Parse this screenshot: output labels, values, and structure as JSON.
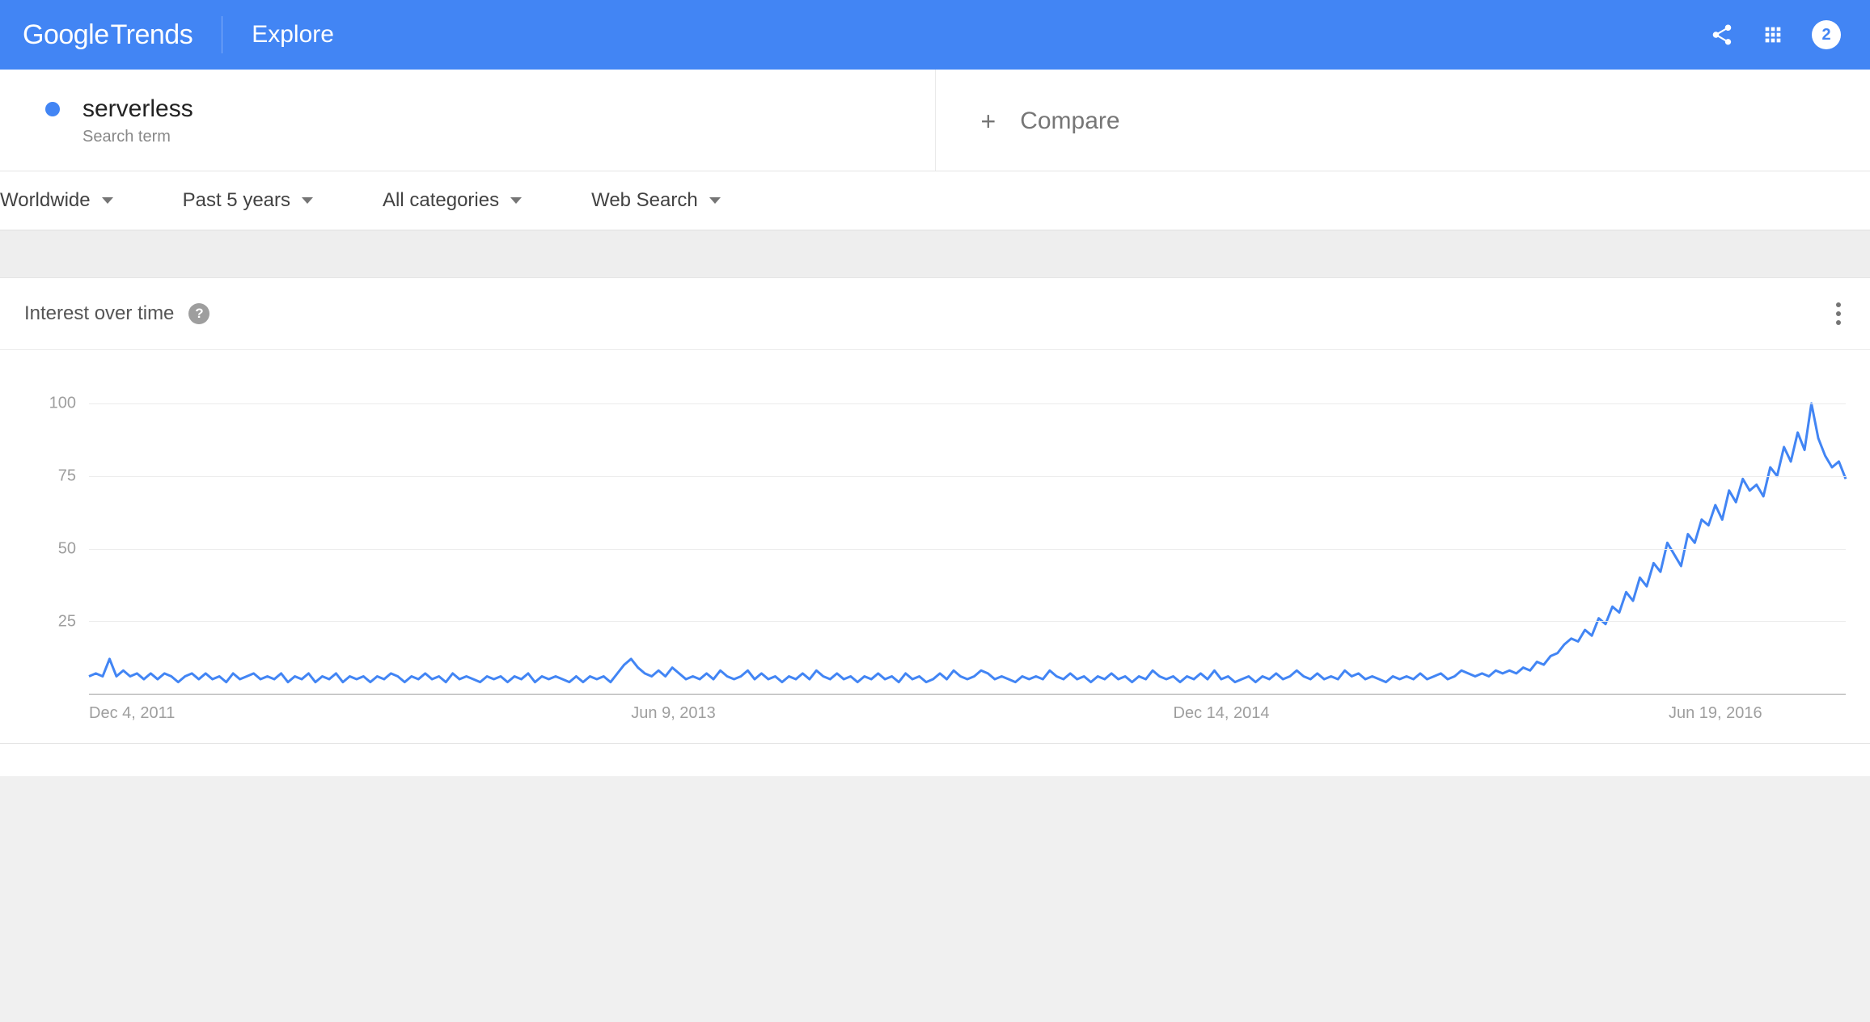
{
  "header": {
    "logo_google": "Google",
    "logo_trends": "Trends",
    "title": "Explore",
    "badge_count": "2"
  },
  "terms": {
    "primary": {
      "name": "serverless",
      "subtitle": "Search term",
      "color": "#4285F4"
    },
    "compare_label": "Compare"
  },
  "filters": {
    "region": "Worldwide",
    "timeframe": "Past 5 years",
    "category": "All categories",
    "search_type": "Web Search"
  },
  "card": {
    "title": "Interest over time"
  },
  "chart_data": {
    "type": "line",
    "title": "Interest over time",
    "xlabel": "",
    "ylabel": "",
    "ylim": [
      0,
      100
    ],
    "y_ticks": [
      25,
      50,
      75,
      100
    ],
    "x_tick_labels": [
      "Dec 4, 2011",
      "Jun 9, 2013",
      "Dec 14, 2014",
      "Jun 19, 2016"
    ],
    "x_tick_positions": [
      0,
      79,
      158,
      237
    ],
    "series": [
      {
        "name": "serverless",
        "color": "#4285F4",
        "values": [
          6,
          7,
          6,
          12,
          6,
          8,
          6,
          7,
          5,
          7,
          5,
          7,
          6,
          4,
          6,
          7,
          5,
          7,
          5,
          6,
          4,
          7,
          5,
          6,
          7,
          5,
          6,
          5,
          7,
          4,
          6,
          5,
          7,
          4,
          6,
          5,
          7,
          4,
          6,
          5,
          6,
          4,
          6,
          5,
          7,
          6,
          4,
          6,
          5,
          7,
          5,
          6,
          4,
          7,
          5,
          6,
          5,
          4,
          6,
          5,
          6,
          4,
          6,
          5,
          7,
          4,
          6,
          5,
          6,
          5,
          4,
          6,
          4,
          6,
          5,
          6,
          4,
          7,
          10,
          12,
          9,
          7,
          6,
          8,
          6,
          9,
          7,
          5,
          6,
          5,
          7,
          5,
          8,
          6,
          5,
          6,
          8,
          5,
          7,
          5,
          6,
          4,
          6,
          5,
          7,
          5,
          8,
          6,
          5,
          7,
          5,
          6,
          4,
          6,
          5,
          7,
          5,
          6,
          4,
          7,
          5,
          6,
          4,
          5,
          7,
          5,
          8,
          6,
          5,
          6,
          8,
          7,
          5,
          6,
          5,
          4,
          6,
          5,
          6,
          5,
          8,
          6,
          5,
          7,
          5,
          6,
          4,
          6,
          5,
          7,
          5,
          6,
          4,
          6,
          5,
          8,
          6,
          5,
          6,
          4,
          6,
          5,
          7,
          5,
          8,
          5,
          6,
          4,
          5,
          6,
          4,
          6,
          5,
          7,
          5,
          6,
          8,
          6,
          5,
          7,
          5,
          6,
          5,
          8,
          6,
          7,
          5,
          6,
          5,
          4,
          6,
          5,
          6,
          5,
          7,
          5,
          6,
          7,
          5,
          6,
          8,
          7,
          6,
          7,
          6,
          8,
          7,
          8,
          7,
          9,
          8,
          11,
          10,
          13,
          14,
          17,
          19,
          18,
          22,
          20,
          26,
          24,
          30,
          28,
          35,
          32,
          40,
          37,
          45,
          42,
          52,
          48,
          44,
          55,
          52,
          60,
          58,
          65,
          60,
          70,
          66,
          74,
          70,
          72,
          68,
          78,
          75,
          85,
          80,
          90,
          84,
          100,
          88,
          82,
          78,
          80,
          74
        ]
      }
    ]
  }
}
